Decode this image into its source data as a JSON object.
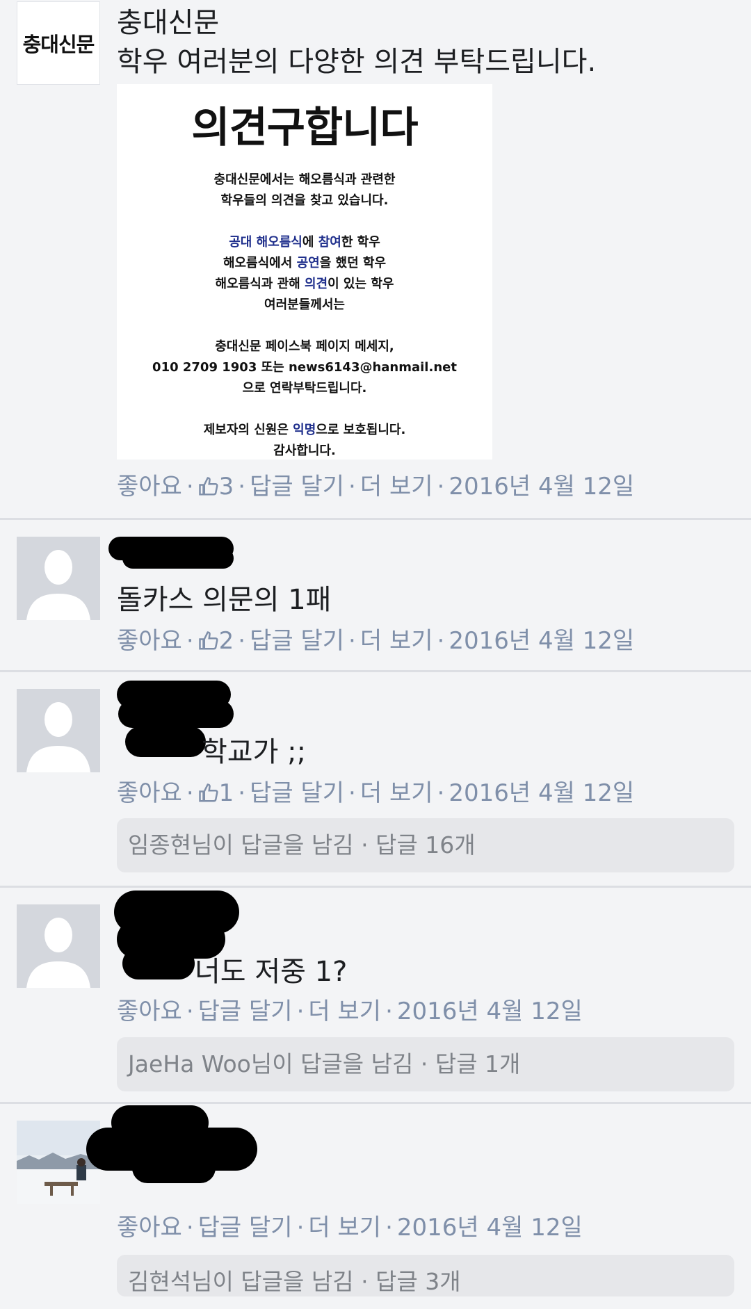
{
  "post": {
    "page_name": "충대신문",
    "avatar_text": "충대신문",
    "text": "학우 여러분의 다양한 의견 부탁드립니다.",
    "poster": {
      "title": "의견구합니다",
      "l1": "충대신문에서는 해오름식과 관련한",
      "l2": "학우들의 의견을 찾고 있습니다.",
      "l3a": "공대 해오름식",
      "l3b": "에 ",
      "l3c": "참여",
      "l3d": "한 학우",
      "l4a": "해오름식에서 ",
      "l4b": "공연",
      "l4c": "을 했던 학우",
      "l5a": "해오름식과 관해 ",
      "l5b": "의견",
      "l5c": "이 있는 학우",
      "l6": "여러분들께서는",
      "l7": "충대신문 페이스북 페이지 메세지,",
      "l8": "010 2709 1903 또는 news6143@hanmail.net",
      "l9": "으로 연락부탁드립니다.",
      "l10a": "제보자의 신원은 ",
      "l10b": "익명",
      "l10c": "으로 보호됩니다.",
      "l11": "감사합니다."
    },
    "meta": {
      "like": "좋아요",
      "likes": "3",
      "reply": "답글 달기",
      "more": "더 보기",
      "date": "2016년 4월 12일"
    }
  },
  "comments": [
    {
      "text": "돌카스 의문의 1패",
      "meta": {
        "like": "좋아요",
        "likes": "2",
        "reply": "답글 달기",
        "more": "더 보기",
        "date": "2016년 4월 12일"
      }
    },
    {
      "text": "학교가 ;;",
      "meta": {
        "like": "좋아요",
        "likes": "1",
        "reply": "답글 달기",
        "more": "더 보기",
        "date": "2016년 4월 12일"
      },
      "replies": "임종현님이 답글을 남김 · 답글 16개"
    },
    {
      "text": "너도 저중 1?",
      "meta": {
        "like": "좋아요",
        "reply": "답글 달기",
        "more": "더 보기",
        "date": "2016년 4월 12일"
      },
      "replies": "JaeHa Woo님이 답글을 남김 · 답글 1개"
    },
    {
      "meta": {
        "like": "좋아요",
        "reply": "답글 달기",
        "more": "더 보기",
        "date": "2016년 4월 12일"
      },
      "replies": "김현석님이 답글을 남김 · 답글 3개"
    }
  ],
  "colors": {
    "meta": "#7f8fa9",
    "highlight": "#1f2f8c",
    "reply_box": "#e6e7ea",
    "divider": "#dcdee3"
  },
  "separator": "·"
}
